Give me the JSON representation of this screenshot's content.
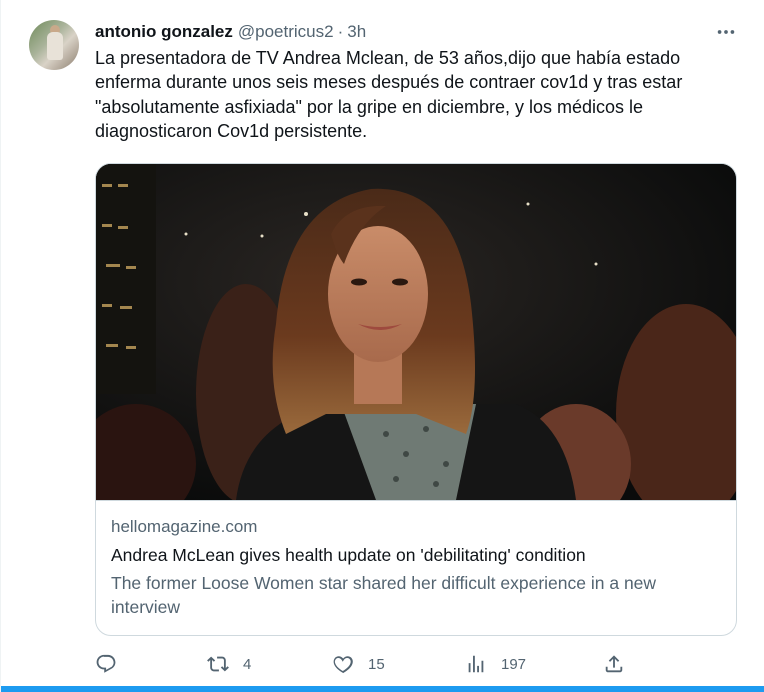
{
  "tweet": {
    "author_name": "antonio gonzalez",
    "handle": "@poetricus2",
    "separator": "·",
    "time": "3h",
    "text": "La presentadora de TV Andrea Mclean, de 53 años,dijo que había estado enferma durante unos seis meses después de contraer cov1d y tras estar \"absolutamente asfixiada\" por la gripe en diciembre, y los médicos le diagnosticaron Cov1d persistente."
  },
  "card": {
    "domain": "hellomagazine.com",
    "title": "Andrea McLean gives health update on 'debilitating' condition",
    "description": "The former Loose Women star shared her difficult experience in a new interview"
  },
  "actions": {
    "reply_count": "",
    "retweet_count": "4",
    "like_count": "15",
    "views_count": "197"
  },
  "colors": {
    "text_primary": "#0f1419",
    "text_secondary": "#536471",
    "border": "#cfd9de",
    "accent": "#1d9bf0"
  },
  "icons": [
    "more-icon",
    "reply-icon",
    "retweet-icon",
    "like-icon",
    "views-icon",
    "share-icon"
  ]
}
